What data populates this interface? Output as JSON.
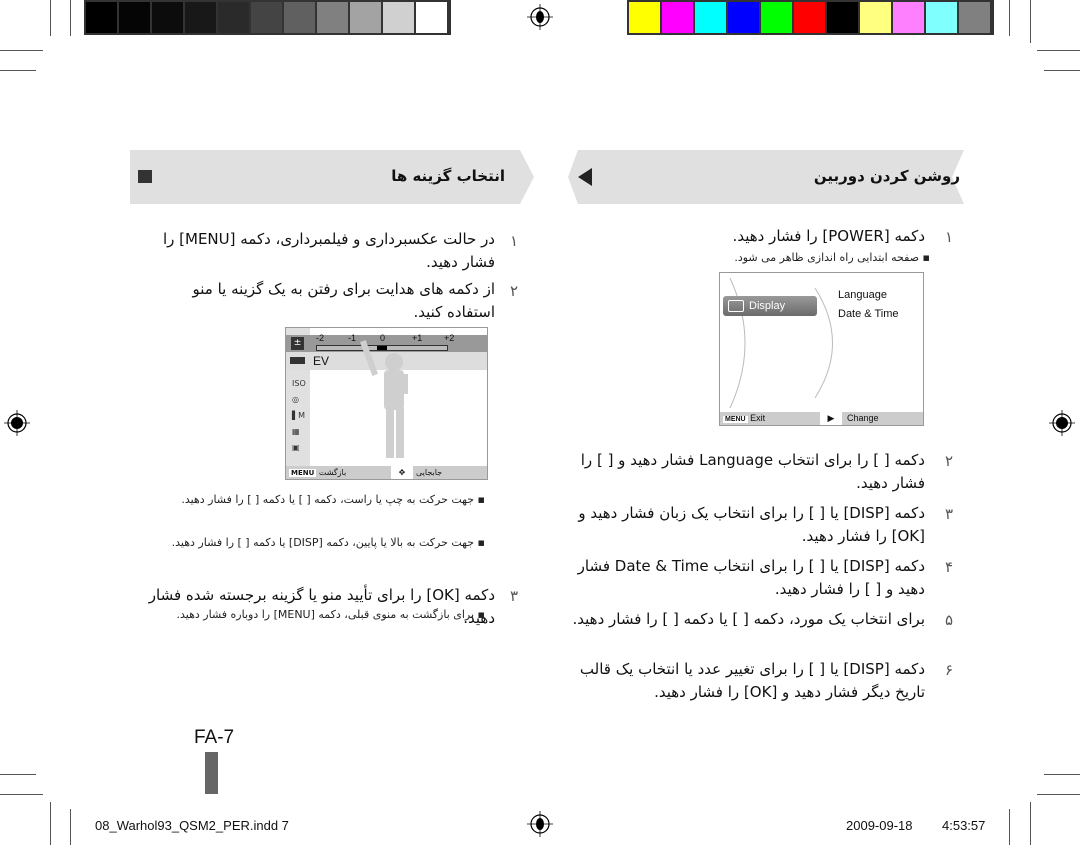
{
  "calibration": {
    "gray_swatches": [
      "#000000",
      "#050505",
      "#0c0c0c",
      "#181818",
      "#2a2a2a",
      "#444444",
      "#606060",
      "#808080",
      "#a3a3a3",
      "#d0d0d0",
      "#ffffff"
    ],
    "color_swatches": [
      "#ffff00",
      "#ff00ff",
      "#00ffff",
      "#0000ff",
      "#00ff00",
      "#ff0000",
      "#000000",
      "#ffff80",
      "#ff80ff",
      "#80ffff",
      "#808080"
    ]
  },
  "right_section": {
    "title": "روشن کردن دوربین",
    "steps": [
      {
        "num": "۱",
        "text": "دکمه [POWER] را فشار دهید.",
        "bullets": [
          "صفحه ابتدایی راه اندازی ظاهر می شود."
        ]
      },
      {
        "num": "۲",
        "text": "دکمه [ ] را برای انتخاب Language فشار دهید و [ ] را فشار دهید."
      },
      {
        "num": "۳",
        "text": "دکمه [DISP] یا [ ] را برای انتخاب یک زبان فشار دهید و [OK] را فشار دهید."
      },
      {
        "num": "۴",
        "text": "دکمه [DISP] یا [ ] را برای انتخاب Date & Time فشار دهید و [ ] را فشار دهید."
      },
      {
        "num": "۵",
        "text": "برای انتخاب یک مورد، دکمه [ ] یا دکمه [ ] را فشار دهید."
      },
      {
        "num": "۶",
        "text": "دکمه [DISP] یا [ ] را برای تغییر عدد یا انتخاب یک قالب تاریخ دیگر فشار دهید و [OK] را فشار دهید."
      }
    ],
    "screen": {
      "menu_item": "Display",
      "options": [
        "Language",
        "Date & Time"
      ],
      "footer_left_key": "MENU",
      "footer_left": "Exit",
      "footer_right": "Change"
    }
  },
  "left_section": {
    "title": "انتخاب گزینه ها",
    "steps": [
      {
        "num": "۱",
        "text": "در حالت عکسبرداری و فیلمبرداری، دکمه [MENU] را فشار دهید."
      },
      {
        "num": "۲",
        "text": "از دکمه های هدایت برای رفتن به یک گزینه یا منو استفاده کنید.",
        "bullets": [
          "جهت حرکت به چپ یا راست، دکمه [ ] یا دکمه [ ] را فشار دهید.",
          "جهت حرکت به بالا یا پایین، دکمه [DISP] یا دکمه [ ] را فشار دهید."
        ]
      },
      {
        "num": "۳",
        "text": "دکمه [OK] را برای تأیید منو یا گزینه برجسته شده فشار دهید.",
        "bullets": [
          "برای بازگشت به منوی قبلی، دکمه [MENU] را دوباره فشار دهید."
        ]
      }
    ],
    "screen": {
      "ev_label": "EV",
      "scale": [
        "-2",
        "-1",
        "0",
        "+1",
        "+2"
      ],
      "ev_value": 0,
      "footer_left_key": "MENU",
      "footer_left": "بازگشت",
      "footer_right": "جابجایی"
    }
  },
  "page_number": "FA-7",
  "footer": {
    "file": "08_Warhol93_QSM2_PER.indd   7",
    "date": "2009-09-18",
    "time": "4:53:57"
  }
}
